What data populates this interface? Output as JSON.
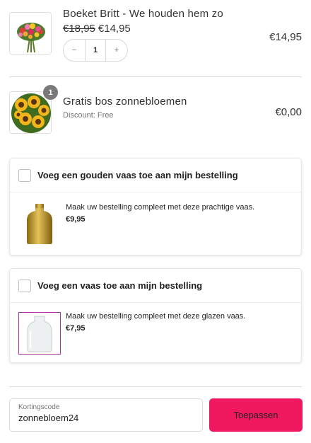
{
  "cart": {
    "items": [
      {
        "title": "Boeket Britt - We houden hem zo",
        "old_price": "€18,95",
        "price": "€14,95",
        "quantity": "1",
        "decrement": "−",
        "increment": "+",
        "total": "€14,95",
        "image_icon": "bouquet-image"
      },
      {
        "title": "Gratis bos zonnebloemen",
        "discount": "Discount: Free",
        "badge": "1",
        "total": "€0,00",
        "image_icon": "sunflowers-image"
      }
    ]
  },
  "upsells": [
    {
      "title": "Voeg een gouden vaas toe aan mijn bestelling",
      "description": "Maak uw bestelling compleet met deze prachtige vaas.",
      "price": "€9,95",
      "image_icon": "gold-vase-image",
      "checked": false
    },
    {
      "title": "Voeg een vaas toe aan mijn bestelling",
      "description": "Maak uw bestelling compleet met deze glazen vaas.",
      "price": "€7,95",
      "image_icon": "glass-vase-image",
      "checked": false
    }
  ],
  "coupon": {
    "label": "Kortingscode",
    "value": "zonnebloem24",
    "apply_label": "Toepassen"
  },
  "colors": {
    "accent": "#f0185f",
    "badge": "#7a7a7a",
    "gold": "#c9a227"
  }
}
